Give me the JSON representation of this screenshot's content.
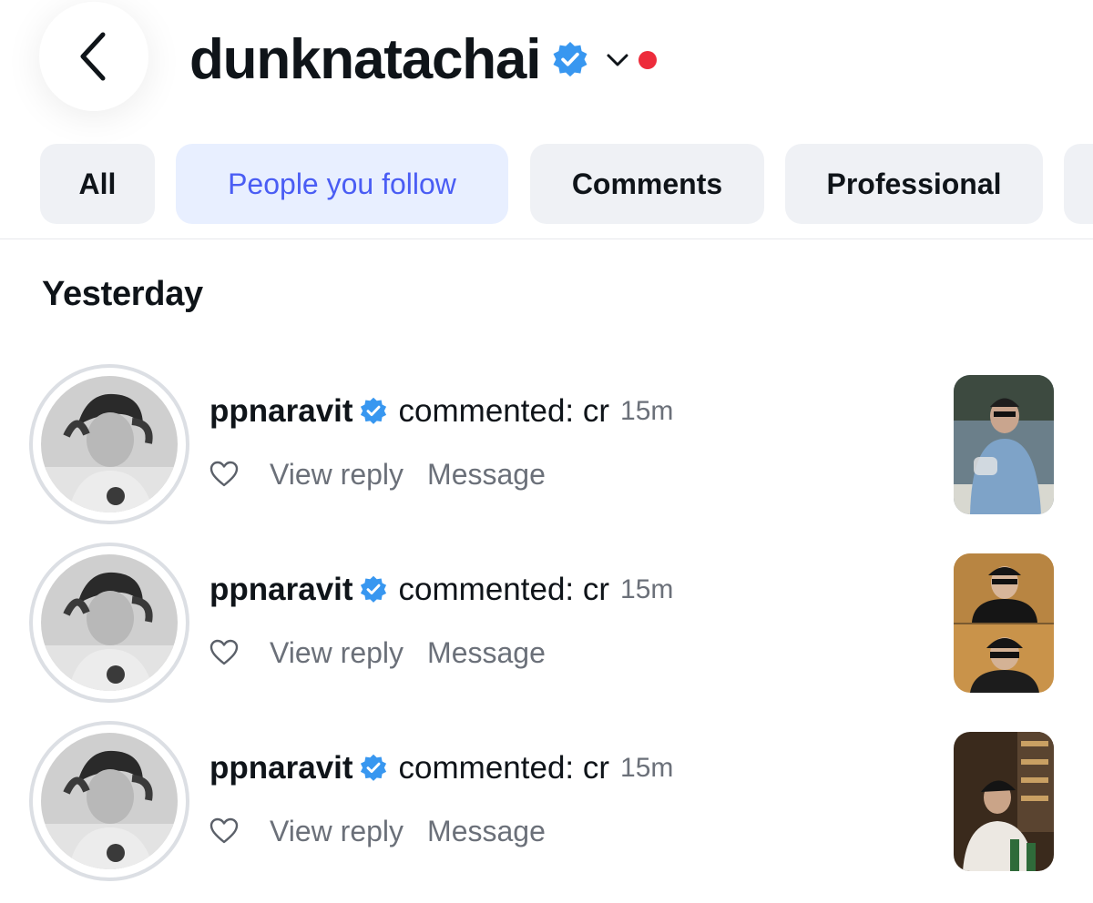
{
  "header": {
    "title": "dunknatachai",
    "back_icon": "chevron-left-icon",
    "verified_icon": "verified-badge-icon",
    "dropdown_icon": "chevron-down-icon",
    "notification_dot_color": "#ed2c3b"
  },
  "filters": {
    "all": "All",
    "people_you_follow": "People you follow",
    "comments": "Comments",
    "professional": "Professional",
    "selected": "People you follow"
  },
  "section": {
    "title": "Yesterday"
  },
  "notifications": [
    {
      "username": "ppnaravit",
      "text": "commented: cr",
      "time": "15m",
      "view_reply": "View reply",
      "message": "Message"
    },
    {
      "username": "ppnaravit",
      "text": "commented: cr",
      "time": "15m",
      "view_reply": "View reply",
      "message": "Message"
    },
    {
      "username": "ppnaravit",
      "text": "commented: cr",
      "time": "15m",
      "view_reply": "View reply",
      "message": "Message"
    }
  ],
  "colors": {
    "accent": "#4a5df4",
    "verified": "#3897f0",
    "chip_bg": "#eff1f5",
    "chip_active_bg": "#e8efff",
    "muted_text": "#6b7079"
  }
}
